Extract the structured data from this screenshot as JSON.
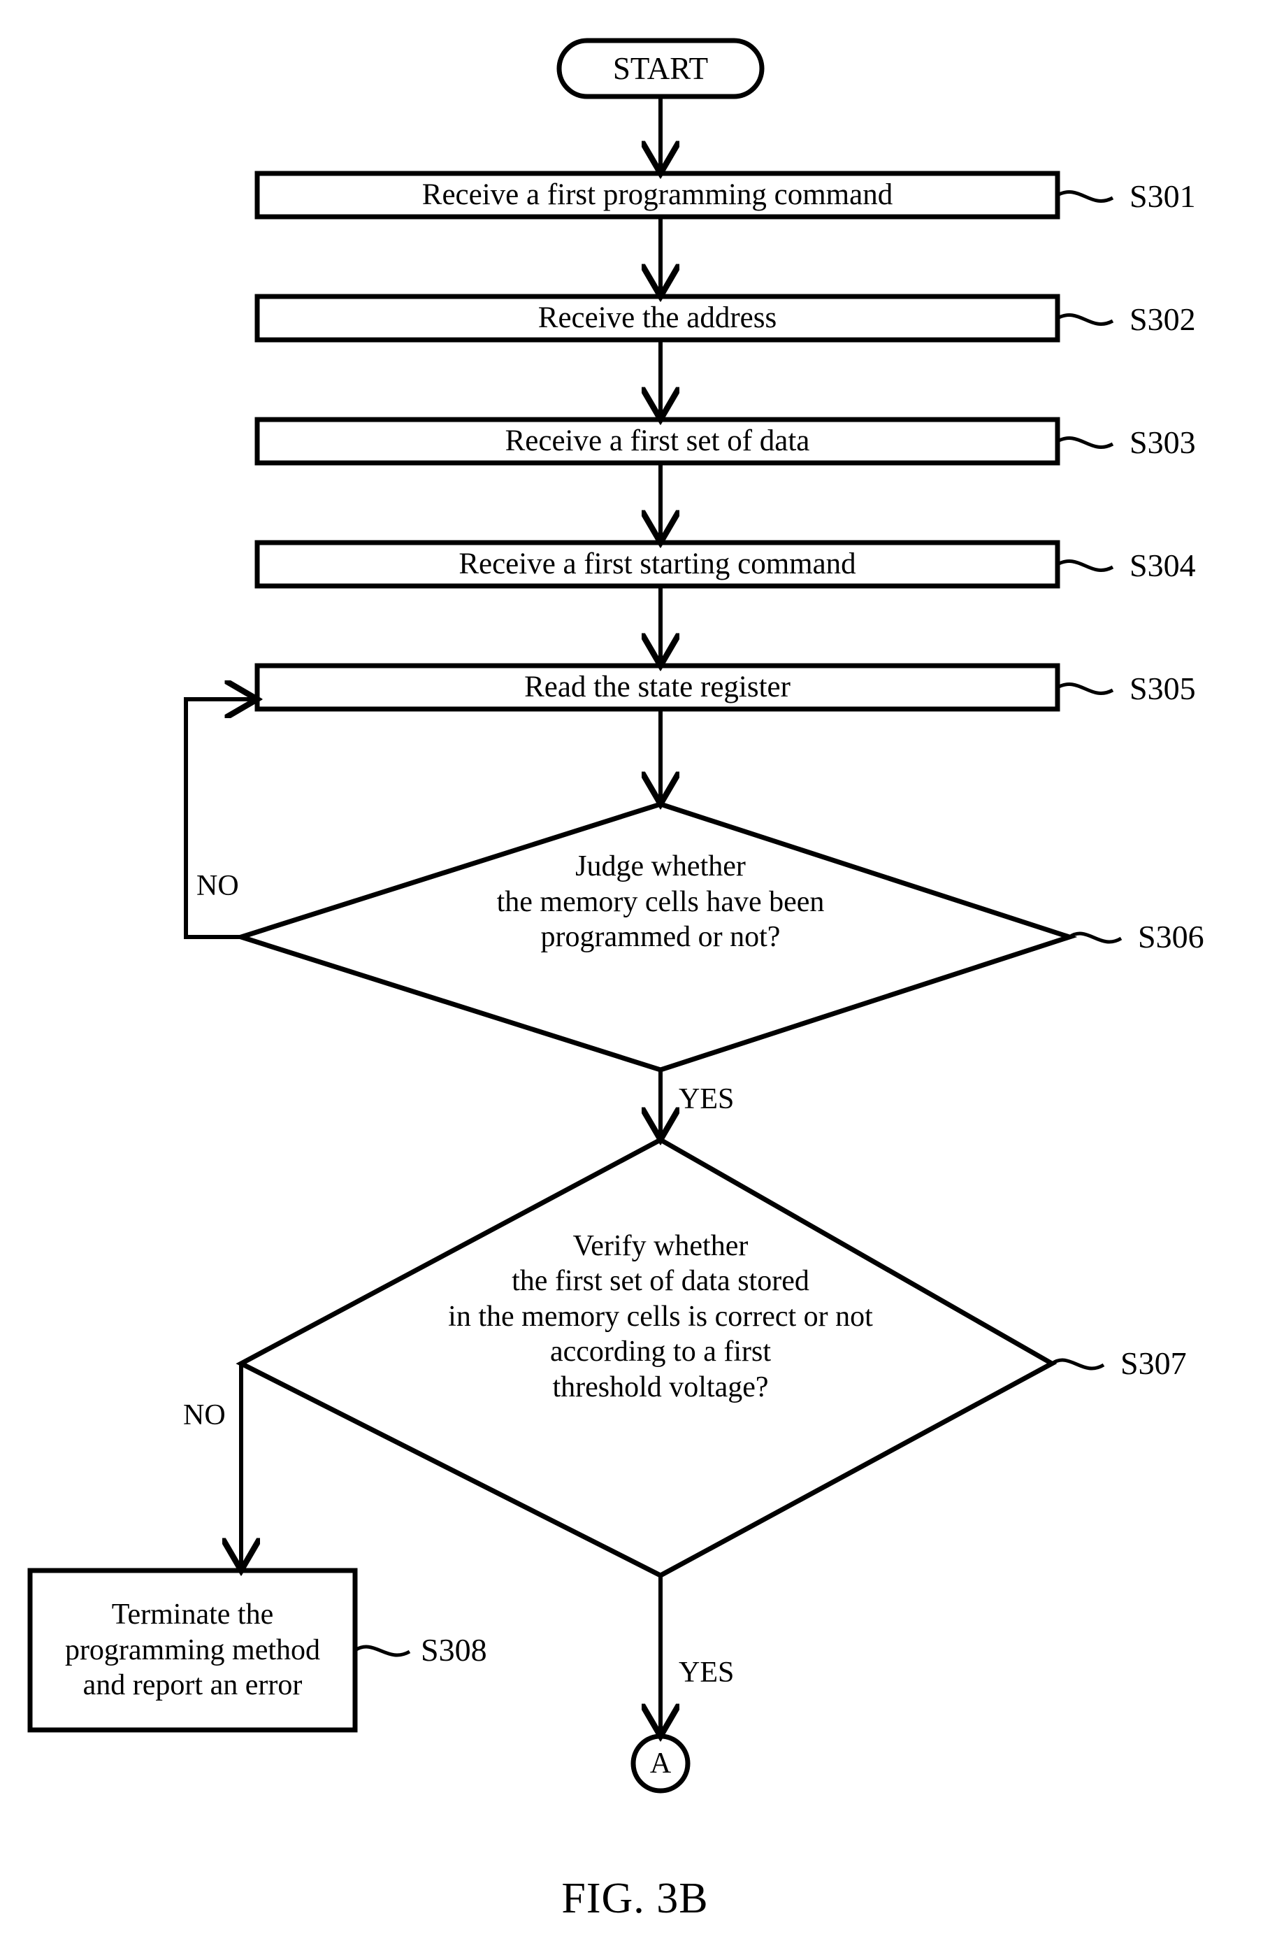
{
  "figure": {
    "caption": "FIG. 3B",
    "type": "flowchart"
  },
  "nodes": {
    "start": {
      "label": "START",
      "shape": "stadium"
    },
    "s301": {
      "label": "Receive a first programming command",
      "tag": "S301",
      "shape": "process"
    },
    "s302": {
      "label": "Receive the address",
      "tag": "S302",
      "shape": "process"
    },
    "s303": {
      "label": "Receive a first set of data",
      "tag": "S303",
      "shape": "process"
    },
    "s304": {
      "label": "Receive a first starting command",
      "tag": "S304",
      "shape": "process"
    },
    "s305": {
      "label": "Read the state register",
      "tag": "S305",
      "shape": "process"
    },
    "s306": {
      "label": "Judge whether\nthe memory cells have been\nprogrammed or not?",
      "tag": "S306",
      "shape": "decision"
    },
    "s307": {
      "label": "Verify whether\nthe first set of data stored\nin the memory cells is correct or not\naccording to a first\nthreshold voltage?",
      "tag": "S307",
      "shape": "decision"
    },
    "s308": {
      "label": "Terminate the\nprogramming method\nand report an error",
      "tag": "S308",
      "shape": "process"
    },
    "connector_a": {
      "label": "A",
      "shape": "circle"
    }
  },
  "branch_labels": {
    "s306_no": "NO",
    "s306_yes": "YES",
    "s307_no": "NO",
    "s307_yes": "YES"
  },
  "colors": {
    "stroke": "#000000",
    "background": "#ffffff",
    "text": "#000000"
  }
}
